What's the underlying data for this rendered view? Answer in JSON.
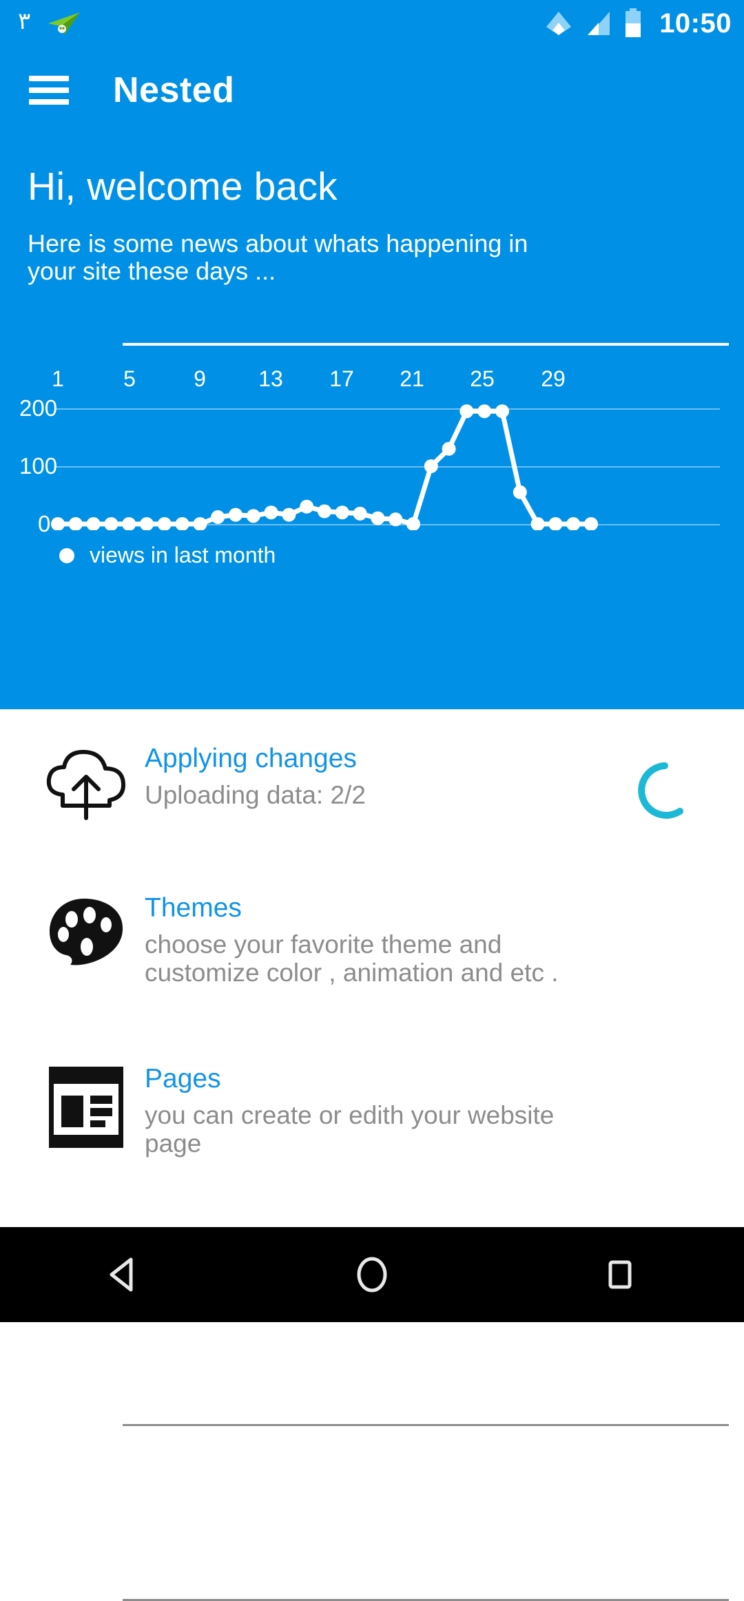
{
  "statusbar": {
    "notification_digit": "٣",
    "plane_icon": "paper-plane-icon",
    "wifi_icon": "wifi-icon",
    "signal_icon": "signal-icon",
    "battery_icon": "battery-icon",
    "clock": "10:50"
  },
  "appbar": {
    "menu_icon": "hamburger-menu-icon",
    "title": "Nested"
  },
  "hero": {
    "greeting": "Hi, welcome back",
    "subtitle": "Here is some news about whats happening in your site these days ..."
  },
  "chart_data": {
    "type": "line",
    "title": "",
    "xlabel": "",
    "ylabel": "",
    "legend": [
      {
        "name": "views in last month",
        "color": "#ffffff"
      }
    ],
    "legend_position": "bottom-left",
    "grid": true,
    "xlim": [
      1,
      31
    ],
    "ylim": [
      0,
      200
    ],
    "xticks": [
      "1",
      "5",
      "9",
      "13",
      "17",
      "21",
      "25",
      "29"
    ],
    "xtick_values": [
      1,
      5,
      9,
      13,
      17,
      21,
      25,
      29
    ],
    "yticks": [
      "0",
      "100",
      "200"
    ],
    "ytick_values": [
      0,
      100,
      200
    ],
    "series": [
      {
        "name": "views in last month",
        "color": "#ffffff",
        "x": [
          1,
          2,
          3,
          4,
          5,
          6,
          7,
          8,
          9,
          10,
          11,
          12,
          13,
          14,
          15,
          16,
          17,
          18,
          19,
          20,
          21,
          22,
          23,
          24,
          25,
          26,
          27,
          28,
          29,
          30,
          31
        ],
        "values": [
          0,
          0,
          0,
          0,
          0,
          0,
          0,
          0,
          0,
          12,
          16,
          14,
          20,
          16,
          30,
          22,
          20,
          18,
          10,
          8,
          0,
          100,
          130,
          195,
          195,
          195,
          55,
          0,
          0,
          0,
          0
        ]
      }
    ]
  },
  "list": {
    "items": [
      {
        "icon": "cloud-upload-icon",
        "title": "Applying changes",
        "desc": "Uploading data: 2/2",
        "trailing_icon": "loading-spinner-icon",
        "trailing_color": "#1bb9d6"
      },
      {
        "icon": "palette-icon",
        "title": "Themes",
        "desc": "choose your favorite theme and customize color , animation and etc ."
      },
      {
        "icon": "pages-article-icon",
        "title": "Pages",
        "desc": "you can create or edith your website page"
      }
    ]
  },
  "navbar": {
    "back_label": "back-icon",
    "home_label": "home-icon",
    "recents_label": "recents-icon"
  },
  "colors": {
    "brand_blue": "#0091e6",
    "link_blue": "#1194e8",
    "muted_grey": "#8c8c8c",
    "spinner_cyan": "#1bb9d6"
  }
}
